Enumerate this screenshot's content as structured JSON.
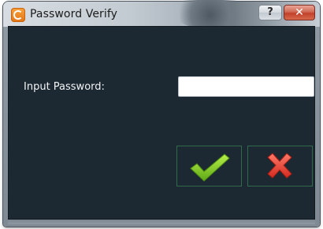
{
  "window": {
    "title": "Password Verify",
    "help_label": "?",
    "close_label": "✕"
  },
  "form": {
    "password_label": "Input Password:",
    "password_value": "",
    "password_placeholder": ""
  },
  "actions": {
    "confirm_icon": "checkmark-icon",
    "cancel_icon": "x-mark-icon"
  },
  "colors": {
    "client_background": "#1d2932",
    "checkmark": "#7fd321",
    "x_mark": "#e33b2b",
    "button_border": "#2f6b4a"
  }
}
